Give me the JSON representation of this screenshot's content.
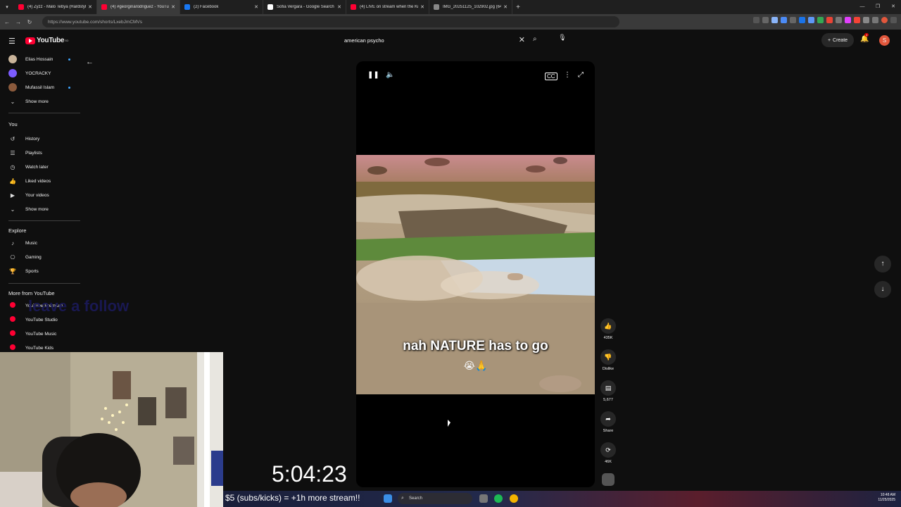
{
  "browser": {
    "tabs": [
      {
        "title": "(4) Zyzz - Malo Tebya (Hardstyle)",
        "color": "#ff0033"
      },
      {
        "title": "(4) #georginarodriguez - YouTube",
        "color": "#ff0033"
      },
      {
        "title": "(2) Facebook",
        "color": "#1877f2"
      },
      {
        "title": "Sofia Vergara - Google Search",
        "color": "#ffffff"
      },
      {
        "title": "(4) LIVE on stream when the Kick",
        "color": "#ff0033"
      },
      {
        "title": "IMG_20251125_102902.jpg (648×",
        "color": "#888888"
      }
    ],
    "url": "https://www.youtube.com/shorts/LxebJmCMVs"
  },
  "header": {
    "logo_text": "YouTube",
    "logo_sup": "BD",
    "search_value": "american psycho",
    "create_label": "Create",
    "notif_count": "4",
    "avatar_letter": "S"
  },
  "sidebar": {
    "subscriptions": [
      {
        "label": "Elias Hossain",
        "color": "#c9b49a",
        "live": true
      },
      {
        "label": "YOCRACKY",
        "color": "#7c5cff",
        "live": false
      },
      {
        "label": "Mufassil Islam",
        "color": "#8b5a3c",
        "live": true
      }
    ],
    "show_more_1": "Show more",
    "you_heading": "You",
    "you_items": [
      {
        "label": "History",
        "icon": "history-icon",
        "glyph": "↺"
      },
      {
        "label": "Playlists",
        "icon": "playlist-icon",
        "glyph": "☰"
      },
      {
        "label": "Watch later",
        "icon": "clock-icon",
        "glyph": "◷"
      },
      {
        "label": "Liked videos",
        "icon": "thumb-up-icon",
        "glyph": "👍"
      },
      {
        "label": "Your videos",
        "icon": "video-icon",
        "glyph": "▶"
      }
    ],
    "show_more_2": "Show more",
    "explore_heading": "Explore",
    "explore_items": [
      {
        "label": "Music",
        "icon": "music-icon",
        "glyph": "♪"
      },
      {
        "label": "Gaming",
        "icon": "gaming-icon",
        "glyph": "⎔"
      },
      {
        "label": "Sports",
        "icon": "trophy-icon",
        "glyph": "🏆"
      }
    ],
    "more_heading": "More from YouTube",
    "more_items": [
      {
        "label": "YouTube Premium"
      },
      {
        "label": "YouTube Studio"
      },
      {
        "label": "YouTube Music"
      },
      {
        "label": "YouTube Kids"
      }
    ]
  },
  "overlay_text": "leave a follow",
  "short": {
    "caption": "nah NATURE has to go",
    "caption_emoji": "😭🙏"
  },
  "actions": {
    "likes": "435K",
    "dislike": "Dislike",
    "comments": "5,677",
    "share": "Share",
    "remix": "46K"
  },
  "stream": {
    "timer": "5:04:23",
    "ticker": "$5 (subs/kicks) = +1h more stream!!"
  },
  "taskbar": {
    "search": "Search",
    "time": "10:48 AM",
    "date": "11/25/2025"
  }
}
